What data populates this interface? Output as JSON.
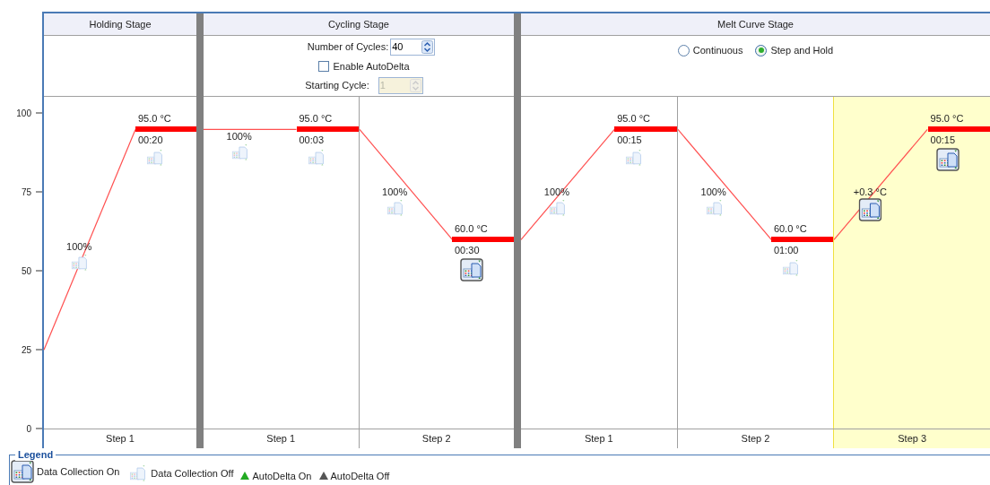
{
  "y_axis": {
    "ticks": [
      "100",
      "75",
      "50",
      "25",
      "0"
    ]
  },
  "stages": [
    {
      "kind": "holding",
      "title": "Holding Stage",
      "steps": [
        {
          "label": "Step 1",
          "selected": false,
          "ramp": {
            "text": "100%",
            "collect": false
          },
          "hold": {
            "temperature": "95.0 °C",
            "time": "00:20",
            "collect": false,
            "kind": "high"
          }
        }
      ]
    },
    {
      "kind": "cycling",
      "title": "Cycling Stage",
      "cycles": {
        "label": "Number of Cycles:",
        "value": "40"
      },
      "autodelta": {
        "label": "Enable AutoDelta",
        "checked": false
      },
      "starting_cycle": {
        "label": "Starting Cycle:",
        "value": "1",
        "disabled": true
      },
      "steps": [
        {
          "label": "Step 1",
          "selected": false,
          "ramp": {
            "text": "100%",
            "collect": false
          },
          "hold": {
            "temperature": "95.0 °C",
            "time": "00:03",
            "collect": false,
            "kind": "high"
          }
        },
        {
          "label": "Step 2",
          "selected": false,
          "ramp": {
            "text": "100%",
            "collect": false
          },
          "hold": {
            "temperature": "60.0 °C",
            "time": "00:30",
            "collect": true,
            "kind": "low"
          }
        }
      ]
    },
    {
      "kind": "melt",
      "title": "Melt Curve Stage",
      "modes": [
        {
          "label": "Continuous",
          "selected": false
        },
        {
          "label": "Step and Hold",
          "selected": true
        }
      ],
      "steps": [
        {
          "label": "Step 1",
          "selected": false,
          "ramp": {
            "text": "100%",
            "collect": false
          },
          "hold": {
            "temperature": "95.0 °C",
            "time": "00:15",
            "collect": false,
            "kind": "high"
          }
        },
        {
          "label": "Step 2",
          "selected": false,
          "ramp": {
            "text": "100%",
            "collect": false
          },
          "hold": {
            "temperature": "60.0 °C",
            "time": "01:00",
            "collect": false,
            "kind": "low"
          }
        },
        {
          "label": "Step 3",
          "selected": true,
          "ramp": {
            "text": "+0.3 °C",
            "collect": true
          },
          "hold": {
            "temperature": "95.0 °C",
            "time": "00:15",
            "collect": true,
            "kind": "high"
          }
        }
      ]
    }
  ],
  "legend": {
    "title": "Legend",
    "items": [
      {
        "kind": "collection_on",
        "label": "Data Collection On"
      },
      {
        "kind": "collection_off",
        "label": "Data Collection Off"
      },
      {
        "kind": "autodelta_on",
        "label": "AutoDelta On"
      },
      {
        "kind": "autodelta_off",
        "label": "AutoDelta Off"
      }
    ]
  }
}
